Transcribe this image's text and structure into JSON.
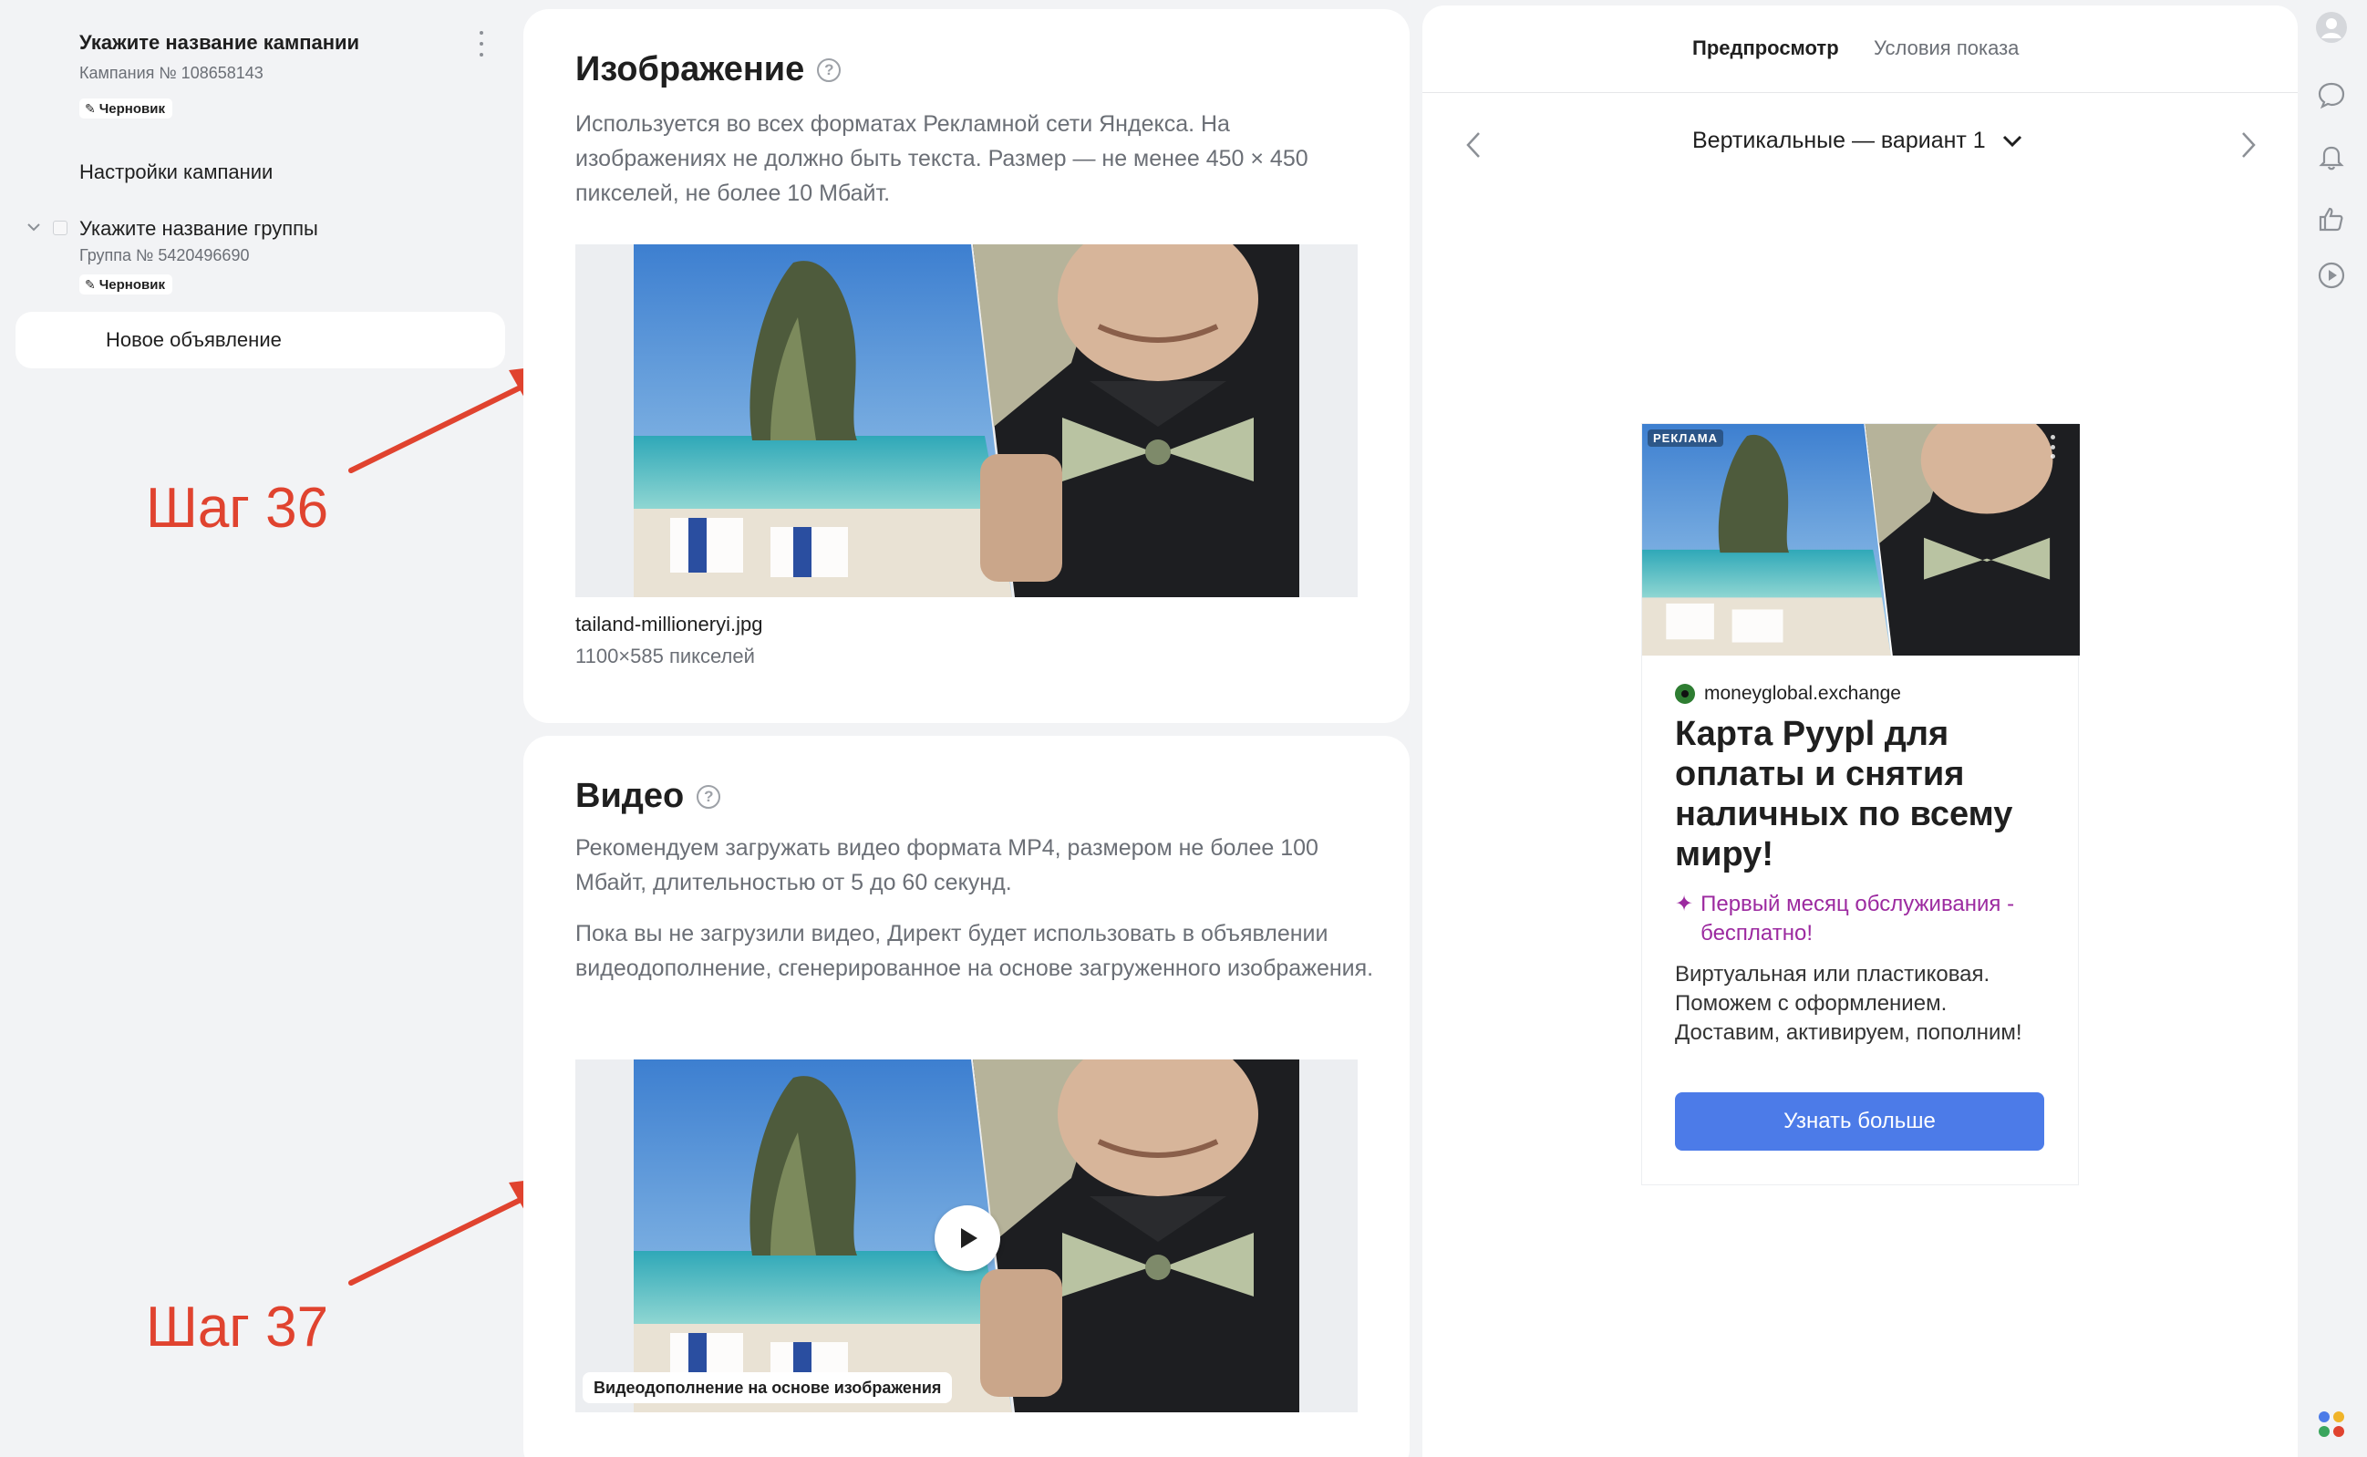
{
  "sidebar": {
    "campaign_title": "Укажите название кампании",
    "campaign_number": "Кампания № 108658143",
    "campaign_badge": "Черновик",
    "settings_label": "Настройки кампании",
    "group_title": "Укажите название группы",
    "group_number": "Группа № 5420496690",
    "group_badge": "Черновик",
    "new_ad_label": "Новое объявление"
  },
  "annotations": {
    "step_36": "Шаг 36",
    "step_37": "Шаг 37",
    "arrow_color": "#e0432f"
  },
  "image_section": {
    "title": "Изображение",
    "description": "Используется во всех форматах Рекламной сети Яндекса. На изображениях не должно быть текста. Размер — не менее 450 × 450 пикселей, не более 10 Мбайт.",
    "file_name": "tailand-millioneryi.jpg",
    "file_size": "1100×585 пикселей"
  },
  "video_section": {
    "title": "Видео",
    "description_1": "Рекомендуем загружать видео формата MP4, размером не более 100 Мбайт, длительностью от 5 до 60 секунд.",
    "description_2": "Пока вы не загрузили видео, Директ будет использовать в объявлении видеодополнение, сгенерированное на основе загруженного изображения.",
    "caption": "Видеодополнение на основе изображения"
  },
  "preview": {
    "tabs": [
      {
        "label": "Предпросмотр",
        "active": true
      },
      {
        "label": "Условия показа",
        "active": false
      }
    ],
    "variant_label": "Вертикальные — вариант 1",
    "ad": {
      "ad_label": "РЕКЛАМА",
      "domain": "moneyglobal.exchange",
      "title": "Карта Pyypl для оплаты и снятия наличных по всему миру!",
      "promo": "Первый месяц обслуживания - бесплатно!",
      "body": "Виртуальная или пластиковая. Поможем с оформлением. Доставим, активируем, пополним!",
      "cta": "Узнать больше",
      "cta_color": "#4c7be8",
      "promo_color": "#9c2aa0"
    }
  },
  "rail_icons": [
    "avatar-icon",
    "chat-icon",
    "bell-icon",
    "thumbs-up-icon",
    "play-circle-icon",
    "apps-icon"
  ]
}
